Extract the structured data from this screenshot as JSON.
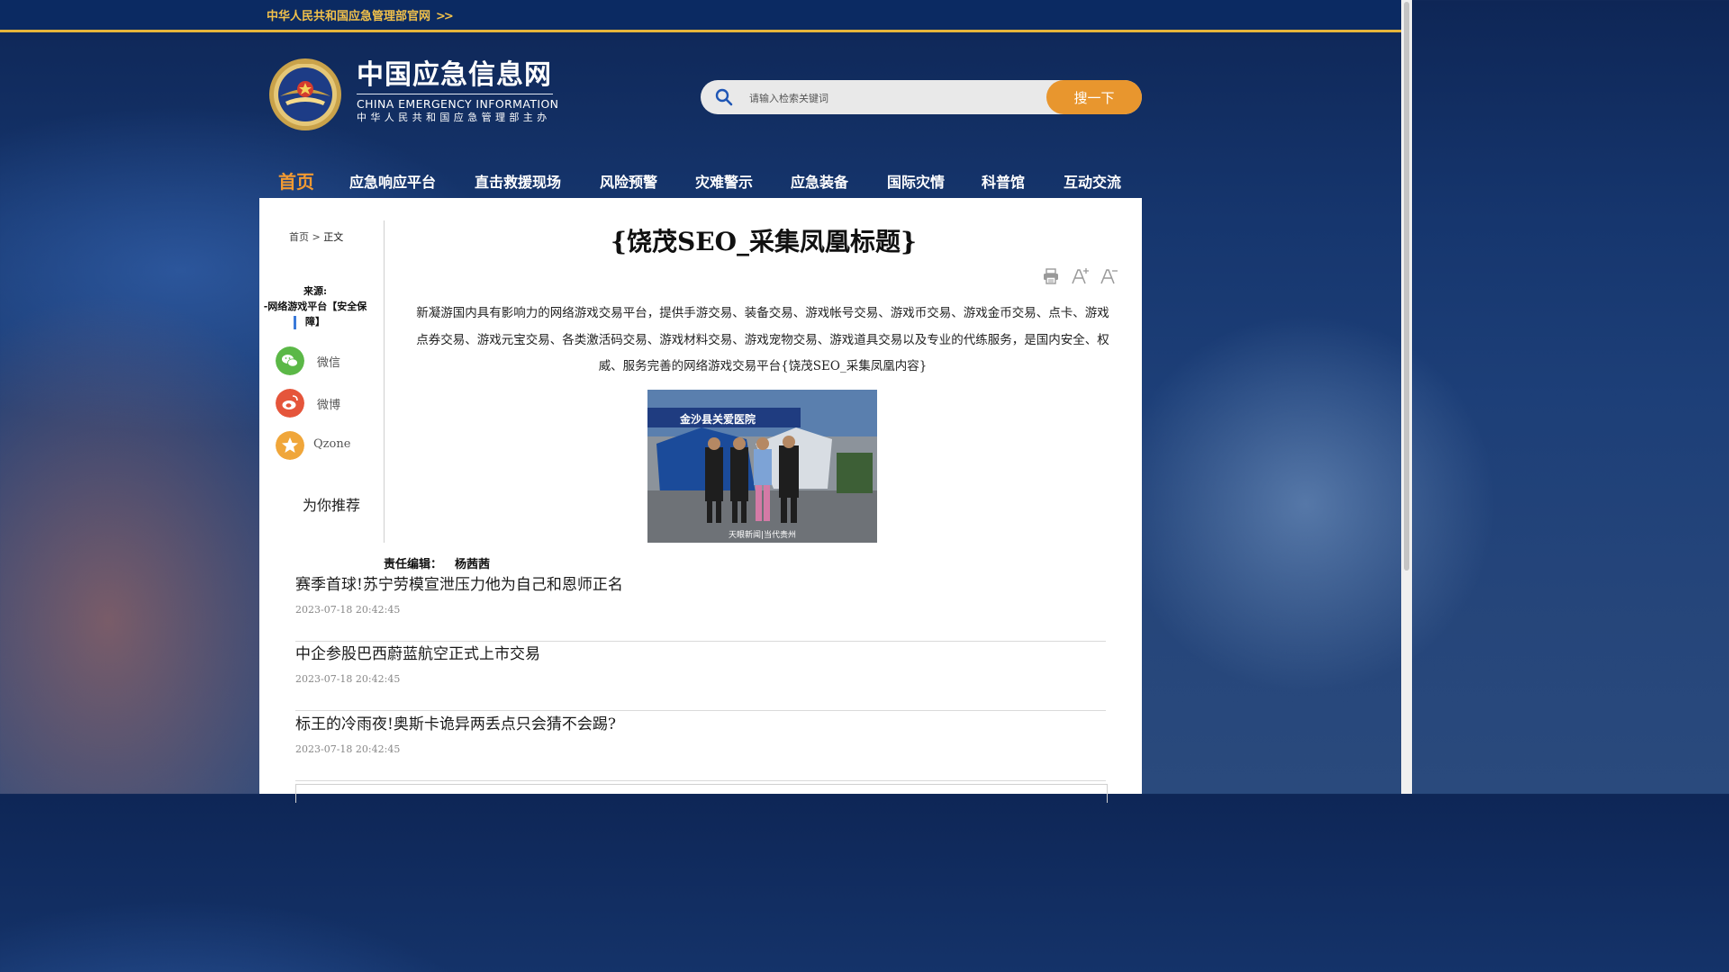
{
  "topbar": {
    "link": "中华人民共和国应急管理部官网",
    "arrow": ">>"
  },
  "site": {
    "name_cn": "中国应急信息网",
    "name_en": "CHINA EMERGENCY INFORMATION",
    "subtitle": "中华人民共和国应急管理部主办"
  },
  "search": {
    "placeholder": "请输入检索关键词",
    "button": "搜一下"
  },
  "nav": [
    "首页",
    "应急响应平台",
    "直击救援现场",
    "风险预警",
    "灾难警示",
    "应急装备",
    "国际灾情",
    "科普馆",
    "互动交流"
  ],
  "breadcrumb": {
    "home": "首页",
    "sep": ">",
    "current": "正文"
  },
  "source": {
    "label": "来源:",
    "value": "-网络游戏平台【安全保障】"
  },
  "share": {
    "wechat": "微信",
    "weibo": "微博",
    "qzone": "Qzone"
  },
  "recommend_title": "为你推荐",
  "article": {
    "title": "{饶茂SEO_采集凤凰标题}",
    "body": "新凝游国内具有影响力的网络游戏交易平台，提供手游交易、装备交易、游戏帐号交易、游戏币交易、游戏金币交易、点卡、游戏点券交易、游戏元宝交易、各类激活码交易、游戏材料交易、游戏宠物交易、游戏道具交易以及专业的代练服务，是国内安全、权威、服务完善的网络游戏交易平台{饶茂SEO_采集凤凰内容}",
    "photo_sign": "金沙县关爱医院",
    "photo_watermark": "天眼新闻|当代贵州",
    "editor_label": "责任编辑：",
    "editor_name": "杨茜茜"
  },
  "recommendations": [
    {
      "title": "赛季首球!苏宁劳模宣泄压力他为自己和恩师正名",
      "date": "2023-07-18 20:42:45"
    },
    {
      "title": "中企参股巴西蔚蓝航空正式上市交易",
      "date": "2023-07-18 20:42:45"
    },
    {
      "title": "标王的冷雨夜!奥斯卡诡异两丢点只会猜不会踢?",
      "date": "2023-07-18 20:42:45"
    }
  ],
  "colors": {
    "accent_gold": "#e6b53b",
    "search_button": "#e8962e",
    "nav_active": "#f29a32",
    "wechat": "#5bb847",
    "weibo": "#e5553b",
    "qzone": "#f0a63a"
  },
  "icons": [
    "search-icon",
    "print-icon",
    "font-increase-icon",
    "font-decrease-icon",
    "wechat-icon",
    "weibo-icon",
    "qzone-icon"
  ]
}
